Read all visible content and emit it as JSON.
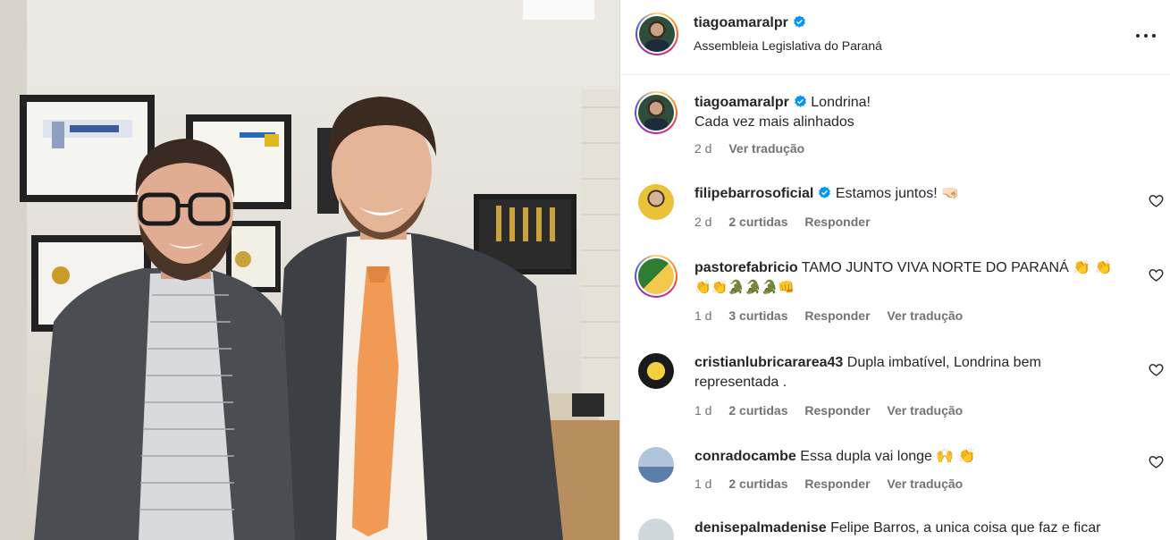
{
  "post": {
    "username": "tiagoamaralpr",
    "location": "Assembleia Legislativa do Paraná",
    "caption_line1": "Londrina!",
    "caption_line2": "Cada vez mais alinhados",
    "caption_time": "2 d",
    "caption_translate": "Ver tradução"
  },
  "comments": [
    {
      "user": "filipebarrosoficial",
      "text": "Estamos juntos! 🤜🏻",
      "time": "2 d",
      "likes": "2 curtidas",
      "reply": "Responder",
      "translate": ""
    },
    {
      "user": "pastorefabricio",
      "text": "TAMO JUNTO VIVA NORTE DO PARANÁ 👏 👏",
      "text2": "👏👏🐊🐊🐊👊",
      "time": "1 d",
      "likes": "3 curtidas",
      "reply": "Responder",
      "translate": "Ver tradução"
    },
    {
      "user": "cristianlubricararea43",
      "text": "Dupla imbatível, Londrina bem",
      "text2": "representada .",
      "time": "1 d",
      "likes": "2 curtidas",
      "reply": "Responder",
      "translate": "Ver tradução"
    },
    {
      "user": "conradocambe",
      "text": "Essa dupla vai longe 🙌 👏",
      "time": "1 d",
      "likes": "2 curtidas",
      "reply": "Responder",
      "translate": "Ver tradução"
    },
    {
      "user": "denisepalmadenise",
      "text": "Felipe Barros, a unica coisa que faz e ficar"
    }
  ],
  "colors": {
    "verified": "#0095f6",
    "muted": "#737373",
    "text": "#262626"
  },
  "icons": [
    "verified-badge-icon",
    "more-options-icon",
    "heart-icon"
  ]
}
